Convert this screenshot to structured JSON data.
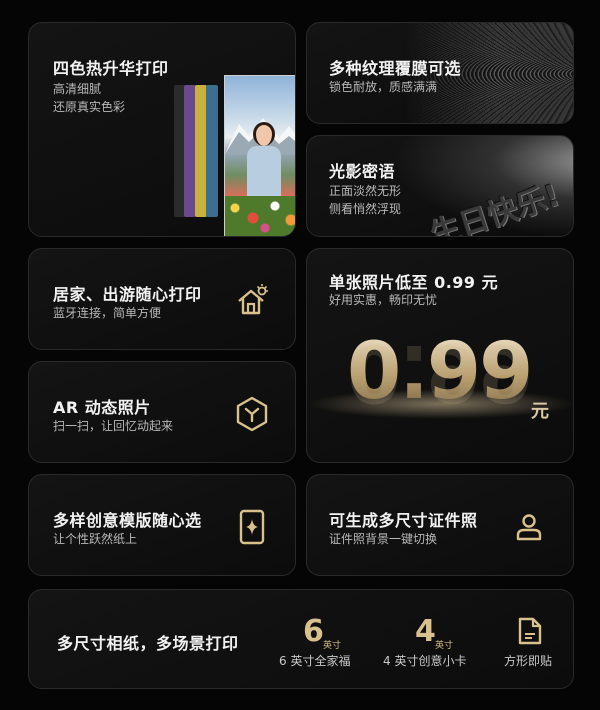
{
  "colors": {
    "accent_gold": "#d9c18e",
    "background": "#050505",
    "card": "#111111"
  },
  "cards": {
    "print": {
      "title": "四色热升华打印",
      "sub1": "高清细腻",
      "sub2": "还原真实色彩"
    },
    "texture": {
      "title": "多种纹理覆膜可选",
      "sub": "锁色耐放，质感满满"
    },
    "light": {
      "title": "光影密语",
      "sub1": "正面淡然无形",
      "sub2": "侧看悄然浮现",
      "emboss_text": "生日快乐!"
    },
    "home": {
      "title": "居家、出游随心打印",
      "sub": "蓝牙连接，简单方便",
      "icon": "house-sun-icon"
    },
    "price": {
      "title": "单张照片低至 0.99 元",
      "sub": "好用实惠，畅印无忧",
      "value": "0.99",
      "unit": "元"
    },
    "ar": {
      "title": "AR 动态照片",
      "sub": "扫一扫，让回忆动起来",
      "icon": "ar-hexagon-icon"
    },
    "template": {
      "title": "多样创意模版随心选",
      "sub": "让个性跃然纸上",
      "icon": "sparkle-frame-icon"
    },
    "idphoto": {
      "title": "可生成多尺寸证件照",
      "sub": "证件照背景一键切换",
      "icon": "person-icon"
    },
    "sizes": {
      "title": "多尺寸相纸，多场景打印",
      "items": [
        {
          "num": "6",
          "unit": "英寸",
          "label": "6 英寸全家福"
        },
        {
          "num": "4",
          "unit": "英寸",
          "label": "4 英寸创意小卡"
        },
        {
          "icon": "square-sticker-icon",
          "label": "方形即贴"
        }
      ]
    }
  }
}
